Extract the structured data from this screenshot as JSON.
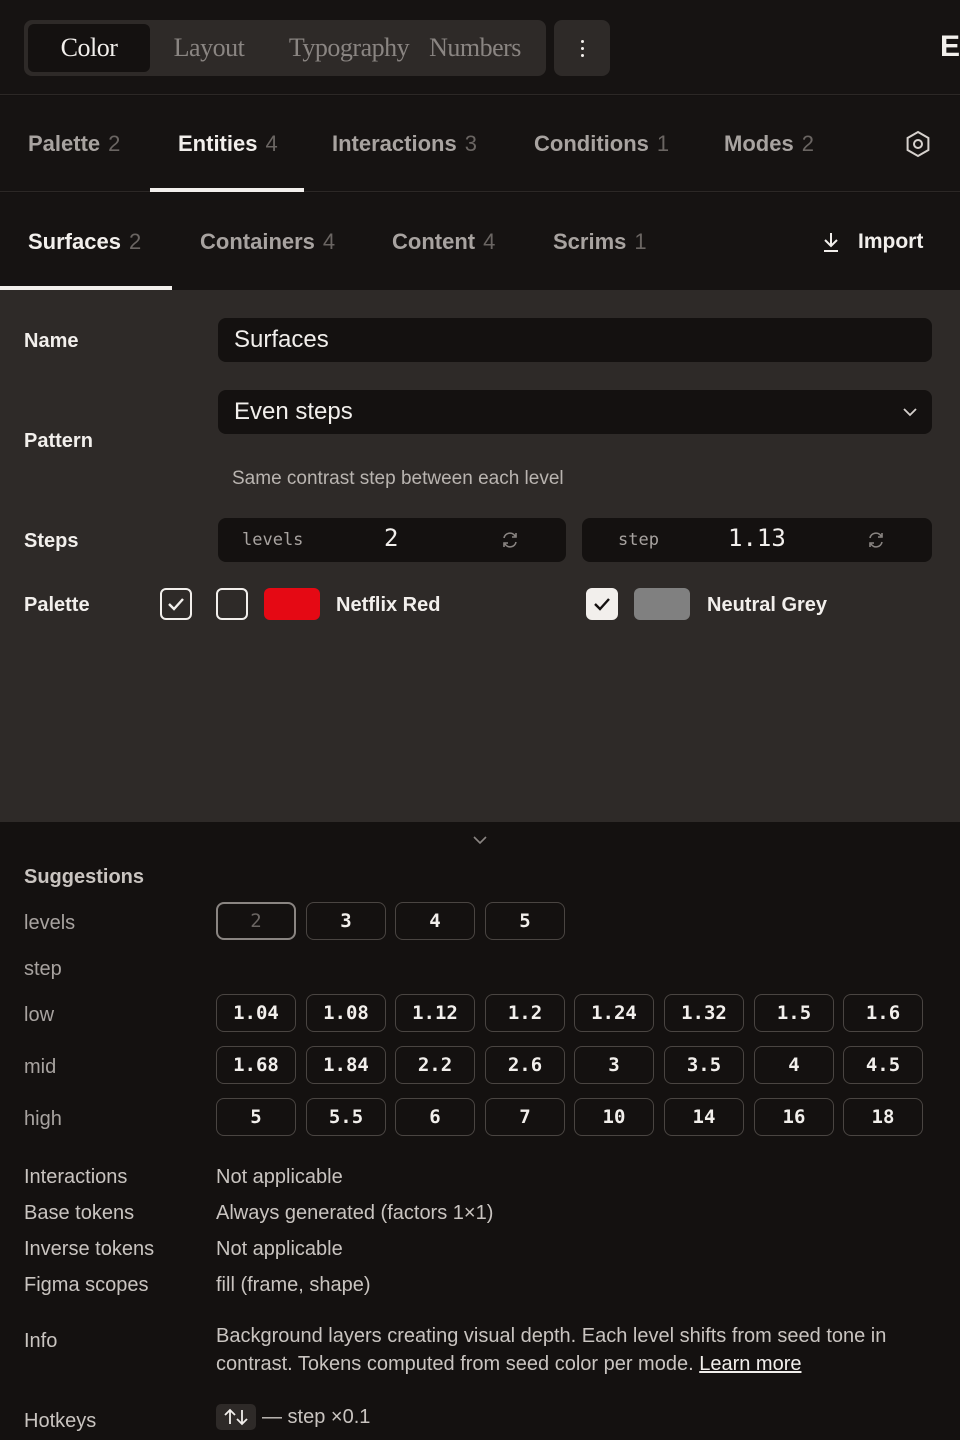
{
  "top": {
    "modes": [
      {
        "label": "Color",
        "active": true
      },
      {
        "label": "Layout",
        "active": false
      },
      {
        "label": "Typography",
        "active": false
      },
      {
        "label": "Numbers",
        "active": false
      }
    ],
    "edge_letter": "E"
  },
  "tabs1": [
    {
      "label": "Palette",
      "count": "2"
    },
    {
      "label": "Entities",
      "count": "4",
      "active": true
    },
    {
      "label": "Interactions",
      "count": "3"
    },
    {
      "label": "Conditions",
      "count": "1"
    },
    {
      "label": "Modes",
      "count": "2"
    }
  ],
  "tabs2": [
    {
      "label": "Surfaces",
      "count": "2",
      "active": true
    },
    {
      "label": "Containers",
      "count": "4"
    },
    {
      "label": "Content",
      "count": "4"
    },
    {
      "label": "Scrims",
      "count": "1"
    }
  ],
  "import_label": "Import",
  "form": {
    "name_label": "Name",
    "name_value": "Surfaces",
    "pattern_label": "Pattern",
    "pattern_value": "Even steps",
    "pattern_hint": "Same contrast step between each level",
    "steps_label": "Steps",
    "levels_key": "levels",
    "levels_value": "2",
    "step_key": "step",
    "step_value": "1.13",
    "palette_label": "Palette",
    "palettes": [
      {
        "name": "Netflix Red",
        "color": "#e50914",
        "checked": false
      },
      {
        "name": "Neutral Grey",
        "color": "#808080",
        "checked": true
      }
    ],
    "all_checked": true
  },
  "suggestions": {
    "title": "Suggestions",
    "levels_label": "levels",
    "levels": [
      "2",
      "3",
      "4",
      "5"
    ],
    "levels_selected": "2",
    "step_label": "step",
    "low_label": "low",
    "low": [
      "1.04",
      "1.08",
      "1.12",
      "1.2",
      "1.24",
      "1.32",
      "1.5",
      "1.6"
    ],
    "mid_label": "mid",
    "mid": [
      "1.68",
      "1.84",
      "2.2",
      "2.6",
      "3",
      "3.5",
      "4",
      "4.5"
    ],
    "high_label": "high",
    "high": [
      "5",
      "5.5",
      "6",
      "7",
      "10",
      "14",
      "16",
      "18"
    ]
  },
  "details": {
    "interactions_label": "Interactions",
    "interactions_value": "Not applicable",
    "base_label": "Base tokens",
    "base_value": "Always generated (factors 1×1)",
    "inverse_label": "Inverse tokens",
    "inverse_value": "Not applicable",
    "figma_label": "Figma scopes",
    "figma_value": "fill (frame, shape)",
    "info_label": "Info",
    "info_text": "Background layers creating visual depth. Each level shifts from seed tone in contrast. Tokens computed from seed color per mode. ",
    "learn_more": "Learn more",
    "hotkeys_label": "Hotkeys",
    "hotkey_key": "↑↓",
    "hotkey_text": "— step ×0.1"
  }
}
